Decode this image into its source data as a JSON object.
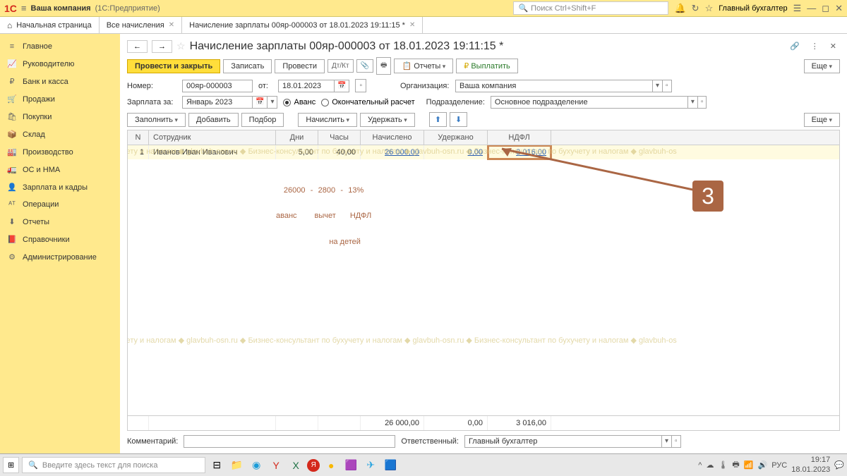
{
  "titlebar": {
    "company": "Ваша компания",
    "suffix": "(1С:Предприятие)",
    "search_placeholder": "Поиск Ctrl+Shift+F",
    "user": "Главный бухгалтер"
  },
  "tabs": {
    "home": "Начальная страница",
    "all": "Все начисления",
    "active": "Начисление зарплаты 00яр-000003 от 18.01.2023 19:11:15 *"
  },
  "nav": [
    "Главное",
    "Руководителю",
    "Банк и касса",
    "Продажи",
    "Покупки",
    "Склад",
    "Производство",
    "ОС и НМА",
    "Зарплата и кадры",
    "Операции",
    "Отчеты",
    "Справочники",
    "Администрирование"
  ],
  "nav_icons": [
    "≡",
    "📈",
    "₽",
    "🛒",
    "🛍",
    "📦",
    "🏭",
    "🚛",
    "👤",
    "ᴬᵀ",
    "⬇",
    "📕",
    "⚙"
  ],
  "doc": {
    "title": "Начисление зарплаты 00яр-000003 от 18.01.2023 19:11:15 *"
  },
  "toolbar": {
    "post_close": "Провести и закрыть",
    "save": "Записать",
    "post": "Провести",
    "reports": "Отчеты",
    "pay": "Выплатить",
    "more": "Еще"
  },
  "form": {
    "number_lbl": "Номер:",
    "number": "00яр-000003",
    "from_lbl": "от:",
    "date": "18.01.2023",
    "org_lbl": "Организация:",
    "org": "Ваша компания",
    "period_lbl": "Зарплата за:",
    "period": "Январь 2023",
    "advance": "Аванс",
    "final": "Окончательный расчет",
    "dept_lbl": "Подразделение:",
    "dept": "Основное подразделение"
  },
  "ttoolbar": {
    "fill": "Заполнить",
    "add": "Добавить",
    "pick": "Подбор",
    "accrue": "Начислить",
    "deduct": "Удержать",
    "more": "Еще"
  },
  "grid": {
    "headers": {
      "n": "N",
      "emp": "Сотрудник",
      "days": "Дни",
      "hours": "Часы",
      "accrued": "Начислено",
      "deducted": "Удержано",
      "tax": "НДФЛ"
    },
    "row": {
      "n": "1",
      "emp": "Иванов Иван Иванович",
      "days": "5,00",
      "hours": "40,00",
      "accrued": "26 000,00",
      "deducted": "0,00",
      "tax": "3 016,00"
    },
    "totals": {
      "accrued": "26 000,00",
      "deducted": "0,00",
      "tax": "3 016,00"
    }
  },
  "bottom": {
    "comment_lbl": "Комментарий:",
    "resp_lbl": "Ответственный:",
    "resp": "Главный бухгалтер"
  },
  "annotation": {
    "v1": "26000",
    "v1s": "аванс",
    "sep": "-",
    "v2": "2800",
    "v2s": "вычет",
    "v2s2": "на детей",
    "v3": "13%",
    "v3s": "НДФЛ",
    "badge": "3"
  },
  "taskbar": {
    "search": "Введите здесь текст для поиска",
    "time": "19:17",
    "date": "18.01.2023",
    "lang": "РУС"
  },
  "watermark": "Бизнес-консультант по бухучету и налогам ◆ glavbuh-osn.ru ◆ Бизнес-консультант по бухучету и налогам ◆ glavbuh-osn.ru ◆ Бизнес-консультант по бухучету и налогам ◆ glavbuh-os"
}
